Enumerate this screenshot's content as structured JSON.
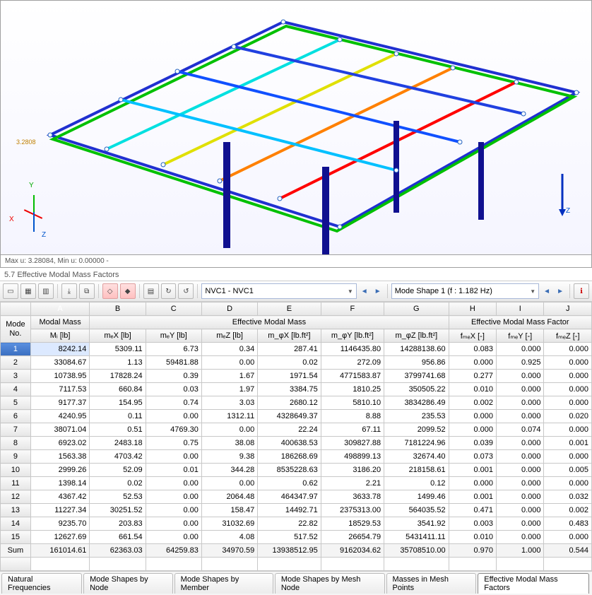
{
  "viewport": {
    "annotation": "3.2808",
    "axis_labels": {
      "x": "X",
      "y": "Y",
      "z": "Z",
      "z2": "Z"
    },
    "status": "Max u: 3.28084, Min u: 0.00000 -"
  },
  "panel_title": "5.7 Effective Modal Mass Factors",
  "toolbar": {
    "combo1": "NVC1 - NVC1",
    "combo2": "Mode Shape 1 (f : 1.182 Hz)"
  },
  "columns": {
    "letters": [
      "A",
      "B",
      "C",
      "D",
      "E",
      "F",
      "G",
      "H",
      "I",
      "J"
    ],
    "group_mode": "Mode\nNo.",
    "group_modal_mass": "Modal Mass",
    "group_eff_mass": "Effective Modal Mass",
    "group_eff_factor": "Effective Modal Mass Factor",
    "h_Mi": "Mᵢ [lb]",
    "h_mex": "mₑX [lb]",
    "h_mey": "mₑY [lb]",
    "h_mez": "mₑZ [lb]",
    "h_mphx": "m_φX [lb.ft²]",
    "h_mphy": "m_φY [lb.ft²]",
    "h_mphz": "m_φZ [lb.ft²]",
    "h_fmx": "fₘₑX [-]",
    "h_fmy": "fₘₑY [-]",
    "h_fmz": "fₘₑZ [-]"
  },
  "rows": [
    {
      "n": "1",
      "Mi": "8242.14",
      "mex": "5309.11",
      "mey": "6.73",
      "mez": "0.34",
      "mphx": "287.41",
      "mphy": "1146435.80",
      "mphz": "14288138.60",
      "fmx": "0.083",
      "fmy": "0.000",
      "fmz": "0.000"
    },
    {
      "n": "2",
      "Mi": "33084.67",
      "mex": "1.13",
      "mey": "59481.88",
      "mez": "0.00",
      "mphx": "0.02",
      "mphy": "272.09",
      "mphz": "956.86",
      "fmx": "0.000",
      "fmy": "0.925",
      "fmz": "0.000"
    },
    {
      "n": "3",
      "Mi": "10738.95",
      "mex": "17828.24",
      "mey": "0.39",
      "mez": "1.67",
      "mphx": "1971.54",
      "mphy": "4771583.87",
      "mphz": "3799741.68",
      "fmx": "0.277",
      "fmy": "0.000",
      "fmz": "0.000"
    },
    {
      "n": "4",
      "Mi": "7117.53",
      "mex": "660.84",
      "mey": "0.03",
      "mez": "1.97",
      "mphx": "3384.75",
      "mphy": "1810.25",
      "mphz": "350505.22",
      "fmx": "0.010",
      "fmy": "0.000",
      "fmz": "0.000"
    },
    {
      "n": "5",
      "Mi": "9177.37",
      "mex": "154.95",
      "mey": "0.74",
      "mez": "3.03",
      "mphx": "2680.12",
      "mphy": "5810.10",
      "mphz": "3834286.49",
      "fmx": "0.002",
      "fmy": "0.000",
      "fmz": "0.000"
    },
    {
      "n": "6",
      "Mi": "4240.95",
      "mex": "0.11",
      "mey": "0.00",
      "mez": "1312.11",
      "mphx": "4328649.37",
      "mphy": "8.88",
      "mphz": "235.53",
      "fmx": "0.000",
      "fmy": "0.000",
      "fmz": "0.020"
    },
    {
      "n": "7",
      "Mi": "38071.04",
      "mex": "0.51",
      "mey": "4769.30",
      "mez": "0.00",
      "mphx": "22.24",
      "mphy": "67.11",
      "mphz": "2099.52",
      "fmx": "0.000",
      "fmy": "0.074",
      "fmz": "0.000"
    },
    {
      "n": "8",
      "Mi": "6923.02",
      "mex": "2483.18",
      "mey": "0.75",
      "mez": "38.08",
      "mphx": "400638.53",
      "mphy": "309827.88",
      "mphz": "7181224.96",
      "fmx": "0.039",
      "fmy": "0.000",
      "fmz": "0.001"
    },
    {
      "n": "9",
      "Mi": "1563.38",
      "mex": "4703.42",
      "mey": "0.00",
      "mez": "9.38",
      "mphx": "186268.69",
      "mphy": "498899.13",
      "mphz": "32674.40",
      "fmx": "0.073",
      "fmy": "0.000",
      "fmz": "0.000"
    },
    {
      "n": "10",
      "Mi": "2999.26",
      "mex": "52.09",
      "mey": "0.01",
      "mez": "344.28",
      "mphx": "8535228.63",
      "mphy": "3186.20",
      "mphz": "218158.61",
      "fmx": "0.001",
      "fmy": "0.000",
      "fmz": "0.005"
    },
    {
      "n": "11",
      "Mi": "1398.14",
      "mex": "0.02",
      "mey": "0.00",
      "mez": "0.00",
      "mphx": "0.62",
      "mphy": "2.21",
      "mphz": "0.12",
      "fmx": "0.000",
      "fmy": "0.000",
      "fmz": "0.000"
    },
    {
      "n": "12",
      "Mi": "4367.42",
      "mex": "52.53",
      "mey": "0.00",
      "mez": "2064.48",
      "mphx": "464347.97",
      "mphy": "3633.78",
      "mphz": "1499.46",
      "fmx": "0.001",
      "fmy": "0.000",
      "fmz": "0.032"
    },
    {
      "n": "13",
      "Mi": "11227.34",
      "mex": "30251.52",
      "mey": "0.00",
      "mez": "158.47",
      "mphx": "14492.71",
      "mphy": "2375313.00",
      "mphz": "564035.52",
      "fmx": "0.471",
      "fmy": "0.000",
      "fmz": "0.002"
    },
    {
      "n": "14",
      "Mi": "9235.70",
      "mex": "203.83",
      "mey": "0.00",
      "mez": "31032.69",
      "mphx": "22.82",
      "mphy": "18529.53",
      "mphz": "3541.92",
      "fmx": "0.003",
      "fmy": "0.000",
      "fmz": "0.483"
    },
    {
      "n": "15",
      "Mi": "12627.69",
      "mex": "661.54",
      "mey": "0.00",
      "mez": "4.08",
      "mphx": "517.52",
      "mphy": "26654.79",
      "mphz": "5431411.11",
      "fmx": "0.010",
      "fmy": "0.000",
      "fmz": "0.000"
    }
  ],
  "sum": {
    "n": "Sum",
    "Mi": "161014.61",
    "mex": "62363.03",
    "mey": "64259.83",
    "mez": "34970.59",
    "mphx": "13938512.95",
    "mphy": "9162034.62",
    "mphz": "35708510.00",
    "fmx": "0.970",
    "fmy": "1.000",
    "fmz": "0.544"
  },
  "tabs": [
    {
      "label": "Natural Frequencies",
      "active": false
    },
    {
      "label": "Mode Shapes by Node",
      "active": false
    },
    {
      "label": "Mode Shapes by Member",
      "active": false
    },
    {
      "label": "Mode Shapes by Mesh Node",
      "active": false
    },
    {
      "label": "Masses in Mesh Points",
      "active": false
    },
    {
      "label": "Effective Modal Mass Factors",
      "active": true
    }
  ]
}
